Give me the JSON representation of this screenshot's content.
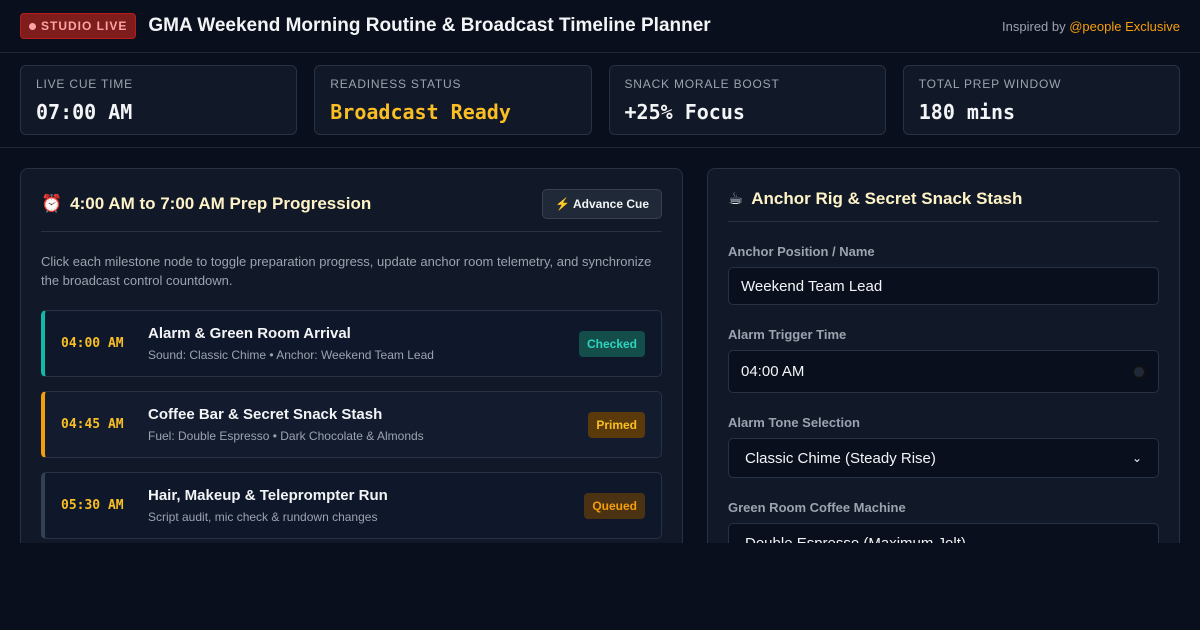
{
  "header": {
    "live_badge": "STUDIO LIVE",
    "title": "GMA Weekend Morning Routine & Broadcast Timeline Planner",
    "inspired_prefix": "Inspired by ",
    "inspired_link": "@people Exclusive"
  },
  "stats": [
    {
      "label": "LIVE CUE TIME",
      "value": "07:00 AM"
    },
    {
      "label": "READINESS STATUS",
      "value": "Broadcast Ready"
    },
    {
      "label": "SNACK MORALE BOOST",
      "value": "+25% Focus"
    },
    {
      "label": "TOTAL PREP WINDOW",
      "value": "180 mins"
    }
  ],
  "progression": {
    "icon": "⏰",
    "title": "4:00 AM to 7:00 AM Prep Progression",
    "advance_label": "⚡ Advance Cue",
    "description": "Click each milestone node to toggle preparation progress, update anchor room telemetry, and synchronize the broadcast control countdown.",
    "milestones": [
      {
        "time": "04:00 AM",
        "title": "Alarm & Green Room Arrival",
        "sub": "Sound: Classic Chime • Anchor: Weekend Team Lead",
        "badge": "Checked"
      },
      {
        "time": "04:45 AM",
        "title": "Coffee Bar & Secret Snack Stash",
        "sub": "Fuel: Double Espresso • Dark Chocolate & Almonds",
        "badge": "Primed"
      },
      {
        "time": "05:30 AM",
        "title": "Hair, Makeup & Teleprompter Run",
        "sub": "Script audit, mic check & rundown changes",
        "badge": "Queued"
      }
    ]
  },
  "rig": {
    "icon": "☕",
    "title": "Anchor Rig & Secret Snack Stash",
    "fields": [
      {
        "label": "Anchor Position / Name",
        "value": "Weekend Team Lead"
      },
      {
        "label": "Alarm Trigger Time",
        "value": "04:00 AM"
      },
      {
        "label": "Alarm Tone Selection",
        "value": "Classic Chime (Steady Rise)"
      },
      {
        "label": "Green Room Coffee Machine",
        "value": "Double Espresso (Maximum Jolt)"
      }
    ]
  },
  "colors": {
    "accent": "#f59e0b",
    "done": "#14b8a6",
    "bg": "#0a0f1d"
  }
}
